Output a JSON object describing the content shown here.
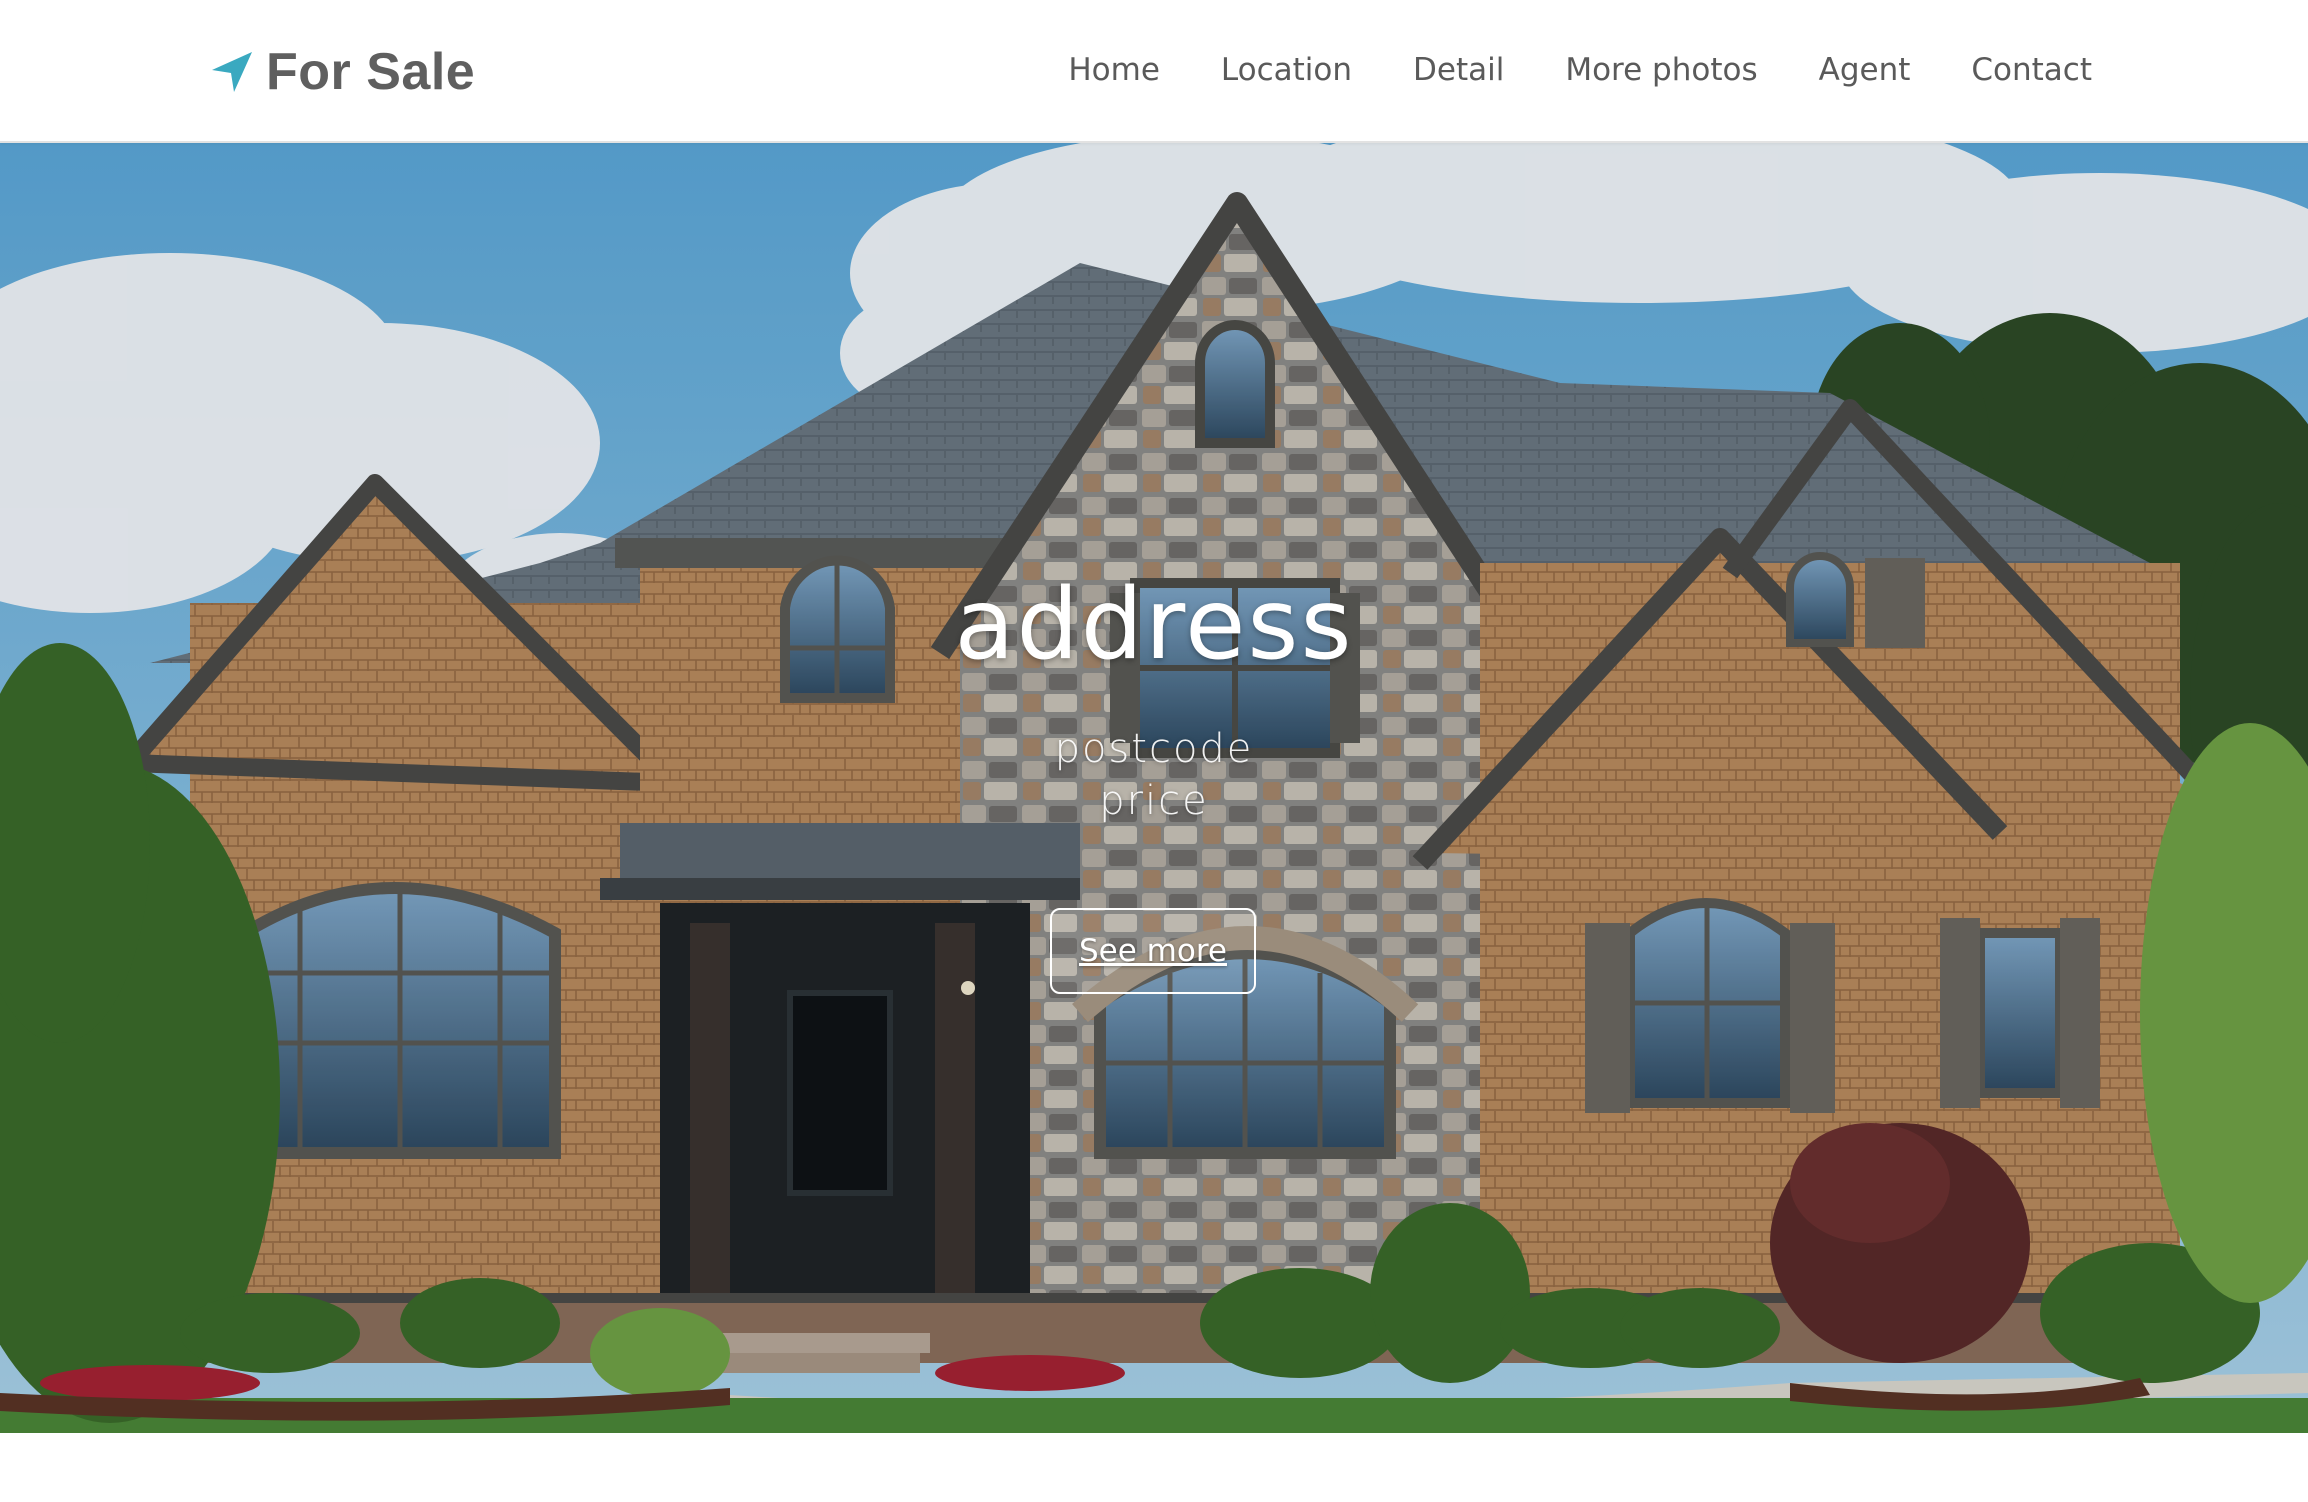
{
  "brand": {
    "name": "For Sale",
    "icon": "location-arrow-icon",
    "icon_color": "#3aa9c0"
  },
  "nav": {
    "items": [
      {
        "label": "Home"
      },
      {
        "label": "Location"
      },
      {
        "label": "Detail"
      },
      {
        "label": "More photos"
      },
      {
        "label": "Agent"
      },
      {
        "label": "Contact"
      }
    ]
  },
  "hero": {
    "title": "address",
    "postcode": "postcode",
    "price": "price",
    "cta_label": "See more"
  },
  "colors": {
    "nav_text": "#5a5a5a",
    "brand_text": "#5f5f5f",
    "hero_text": "#ffffff"
  }
}
